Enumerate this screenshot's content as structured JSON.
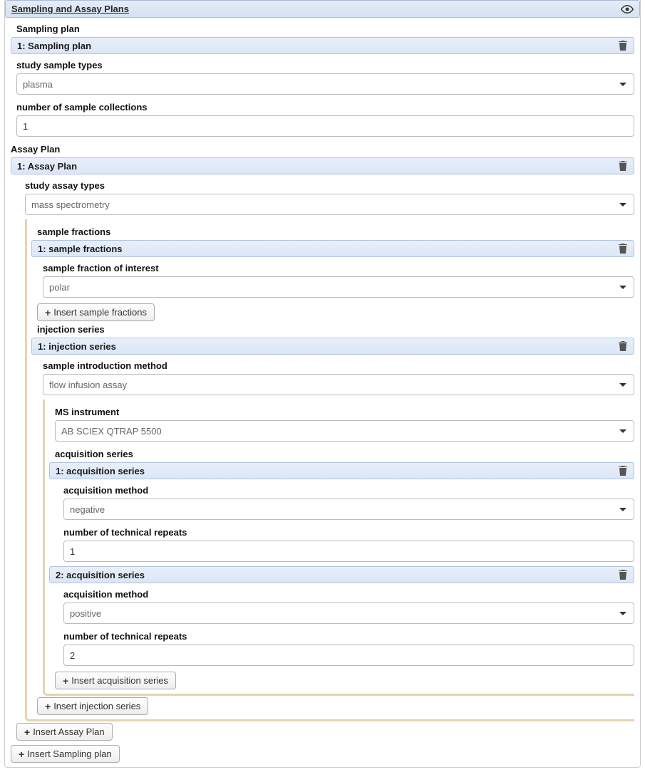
{
  "panel_title": "Sampling and Assay Plans",
  "sampling_section_label": "Sampling plan",
  "sampling_plan": {
    "index_title": "1: Sampling plan",
    "study_sample_types_label": "study sample types",
    "study_sample_types_value": "plasma",
    "num_collections_label": "number of sample collections",
    "num_collections_value": "1"
  },
  "assay_section_label": "Assay Plan",
  "assay_plan": {
    "index_title": "1: Assay Plan",
    "study_assay_types_label": "study assay types",
    "study_assay_types_value": "mass spectrometry",
    "sample_fractions_label": "sample fractions",
    "sample_fractions": {
      "index_title": "1: sample fractions",
      "interest_label": "sample fraction of interest",
      "interest_value": "polar"
    },
    "insert_sample_fractions_label": "Insert sample fractions",
    "injection_series_label": "injection series",
    "injection_series": {
      "index_title": "1: injection series",
      "intro_method_label": "sample introduction method",
      "intro_method_value": "flow infusion assay",
      "ms_instrument_label": "MS instrument",
      "ms_instrument_value": "AB SCIEX QTRAP 5500",
      "acq_series_label": "acquisition series",
      "acq1": {
        "index_title": "1: acquisition series",
        "method_label": "acquisition method",
        "method_value": "negative",
        "repeats_label": "number of technical repeats",
        "repeats_value": "1"
      },
      "acq2": {
        "index_title": "2: acquisition series",
        "method_label": "acquisition method",
        "method_value": "positive",
        "repeats_label": "number of technical repeats",
        "repeats_value": "2"
      },
      "insert_acq_label": "Insert acquisition series"
    },
    "insert_injection_label": "Insert injection series"
  },
  "insert_assay_label": "Insert Assay Plan",
  "insert_sampling_label": "Insert Sampling plan"
}
